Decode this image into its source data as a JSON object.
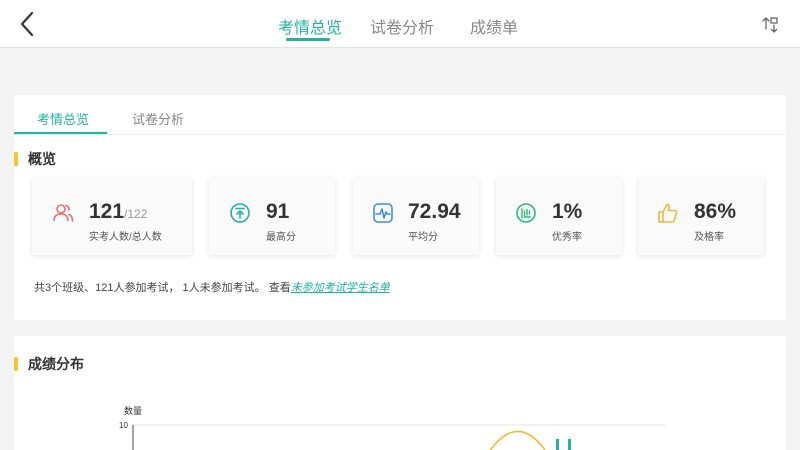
{
  "nav": {
    "tabs": [
      {
        "label": "考情总览",
        "active": true
      },
      {
        "label": "试卷分析",
        "active": false
      },
      {
        "label": "成绩单",
        "active": false
      }
    ]
  },
  "overview": {
    "tabs": [
      {
        "label": "考情总览",
        "active": true
      },
      {
        "label": "试卷分析",
        "active": false
      }
    ],
    "section_title": "概览",
    "stats": [
      {
        "value": "121",
        "sub": "/122",
        "label": "实考人数/总人数",
        "icon": "users-icon",
        "color": "#ef6b6b"
      },
      {
        "value": "91",
        "sub": "",
        "label": "最高分",
        "icon": "arrow-up-circle-icon",
        "color": "#1fb3a3"
      },
      {
        "value": "72.94",
        "sub": "",
        "label": "平均分",
        "icon": "pulse-icon",
        "color": "#3d8fe6"
      },
      {
        "value": "1%",
        "sub": "",
        "label": "优秀率",
        "icon": "excellent-icon",
        "color": "#2db87c"
      },
      {
        "value": "86%",
        "sub": "",
        "label": "及格率",
        "icon": "thumbs-up-icon",
        "color": "#f2b53a"
      }
    ],
    "summary_text": "共3个班级、121人参加考试， 1人未参加考试。 查看",
    "summary_link": "未参加考试学生名单"
  },
  "distribution": {
    "section_title": "成绩分布"
  },
  "chart_data": {
    "type": "bar",
    "ylabel": "数量",
    "yticks": [
      "10"
    ],
    "colors": {
      "curve": "#f5b829",
      "bar": "#1fb3a3"
    }
  }
}
